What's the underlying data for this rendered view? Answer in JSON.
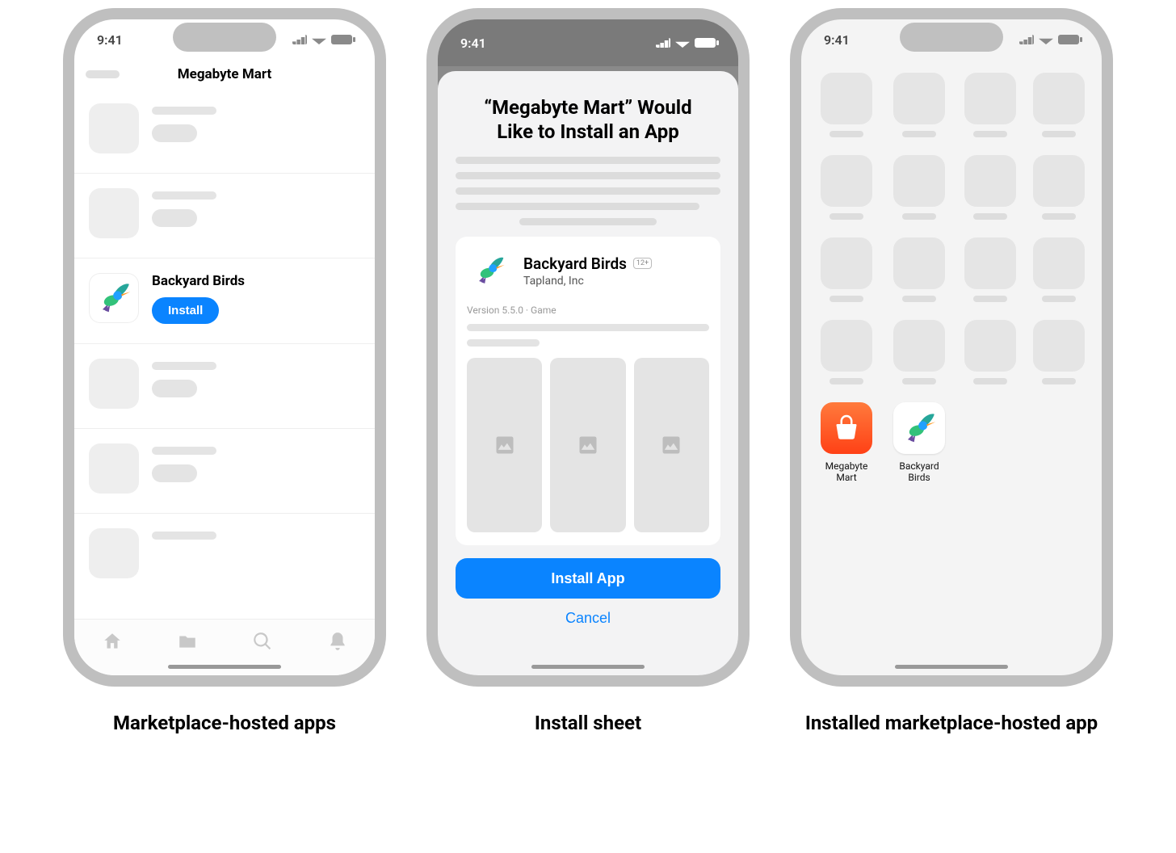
{
  "status_time": "9:41",
  "captions": {
    "s1": "Marketplace-hosted apps",
    "s2": "Install sheet",
    "s3": "Installed marketplace-hosted app"
  },
  "screen1": {
    "marketplace_title": "Megabyte Mart",
    "app_name": "Backyard Birds",
    "install_label": "Install"
  },
  "screen2": {
    "heading": "“Megabyte Mart” Would Like to Install an App",
    "app_name": "Backyard Birds",
    "developer": "Tapland, Inc",
    "age_rating": "12+",
    "meta": "Version 5.5.0 · Game",
    "primary": "Install App",
    "cancel": "Cancel"
  },
  "screen3": {
    "megamart_label": "Megabyte Mart",
    "birds_label": "Backyard Birds"
  }
}
